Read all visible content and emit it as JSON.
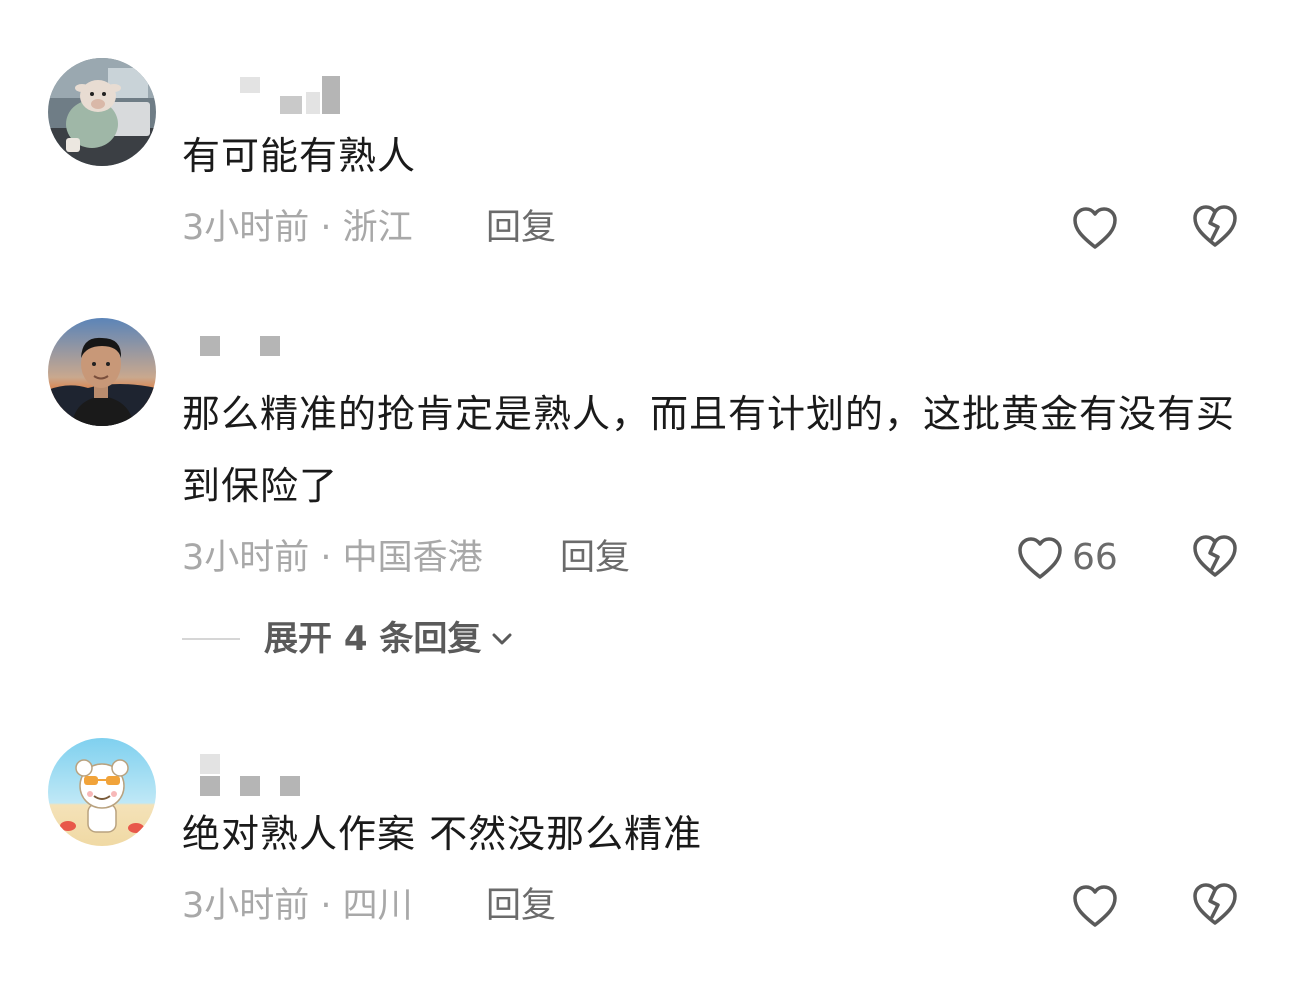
{
  "comments": [
    {
      "avatar": "goat-at-laptop-avatar",
      "text": "有可能有熟人",
      "time": "3小时前",
      "location": "浙江",
      "meta": "3小时前 · 浙江",
      "reply_label": "回复",
      "like_count": "",
      "expand_label": ""
    },
    {
      "avatar": "man-portrait-avatar",
      "text": "那么精准的抢肯定是熟人，而且有计划的，这批黄金有没有买到保险了",
      "time": "3小时前",
      "location": "中国香港",
      "meta": "3小时前 · 中国香港",
      "reply_label": "回复",
      "like_count": "66",
      "expand_label": "展开 4 条回复"
    },
    {
      "avatar": "cartoon-bear-avatar",
      "text": "绝对熟人作案 不然没那么精准",
      "time": "3小时前",
      "location": "四川",
      "meta": "3小时前 · 四川",
      "reply_label": "回复",
      "like_count": "",
      "expand_label": ""
    }
  ],
  "icons": {
    "like": "heart-outline-icon",
    "dislike": "broken-heart-icon",
    "expand": "chevron-down-icon"
  },
  "colors": {
    "text": "#1a1a1a",
    "meta": "#a8a8a8",
    "reply": "#6b6b6b",
    "icon": "#5a5a5a"
  }
}
